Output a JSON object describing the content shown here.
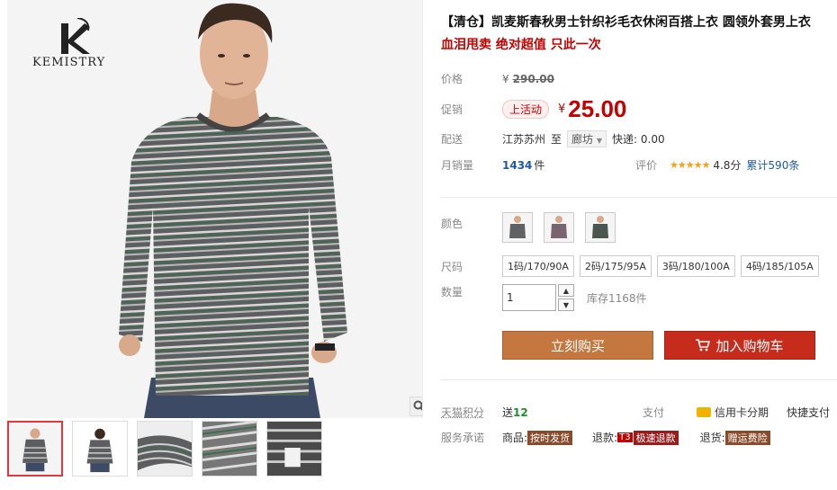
{
  "brand": {
    "name": "KEMISTRY"
  },
  "product": {
    "title": "【清仓】凯麦斯春秋男士针织衫毛衣休闲百搭上衣 圆领外套男上衣",
    "subtitle": "血泪甩卖 绝对超值 只此一次"
  },
  "price": {
    "label": "价格",
    "currency": "¥",
    "original": "290.00",
    "promo_label": "促销",
    "promo_tag": "上活动",
    "current": "25.00"
  },
  "shipping": {
    "label": "配送",
    "from": "江苏苏州",
    "to_word": "至",
    "city": "廊坊",
    "fee": "快递: 0.00"
  },
  "sales": {
    "label": "月销量",
    "count": "1434",
    "unit": "件",
    "rating_label": "评价",
    "stars": "★★★★★",
    "score": "4.8分",
    "total": "累计590条"
  },
  "options": {
    "color_label": "颜色",
    "size_label": "尺码",
    "sizes": [
      "1码/170/90A",
      "2码/175/95A",
      "3码/180/100A",
      "4码/185/105A"
    ],
    "qty_label": "数量",
    "qty_value": "1",
    "stock": "库存1168件"
  },
  "actions": {
    "buy_now": "立刻购买",
    "add_cart": "加入购物车"
  },
  "extras": {
    "points_label": "天猫积分",
    "points_prefix": "送",
    "points_value": "12",
    "pay_label": "支付",
    "installment": "信用卡分期",
    "quick_pay": "快捷支付",
    "service_label": "服务承诺",
    "goods_label": "商品:",
    "goods_tag": "按时发货",
    "refund_label": "退款:",
    "refund_code": "T3",
    "refund_tag": "极速退款",
    "return_label": "退货:",
    "return_tag": "赠运费险"
  },
  "colors": {
    "price_red": "#c40000",
    "buy_btn": "#c4773f",
    "cart_btn": "#c62b1c"
  }
}
